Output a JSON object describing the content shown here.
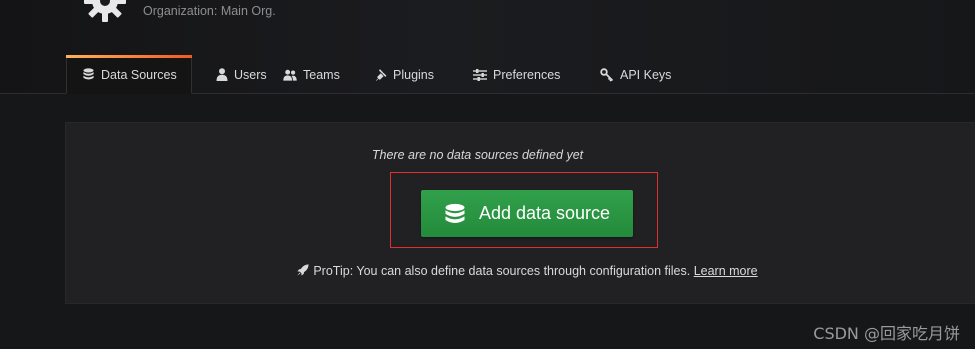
{
  "header": {
    "subtitle": "Organization: Main Org."
  },
  "tabs": [
    {
      "label": "Data Sources",
      "icon": "database-icon",
      "active": true
    },
    {
      "label": "Users",
      "icon": "user-icon",
      "active": false
    },
    {
      "label": "Teams",
      "icon": "users-icon",
      "active": false
    },
    {
      "label": "Plugins",
      "icon": "plug-icon",
      "active": false
    },
    {
      "label": "Preferences",
      "icon": "sliders-icon",
      "active": false
    },
    {
      "label": "API Keys",
      "icon": "key-icon",
      "active": false
    }
  ],
  "empty_state": {
    "message": "There are no data sources defined yet",
    "button_label": "Add data source",
    "protip_text": "ProTip: You can also define data sources through configuration files.",
    "learn_more": "Learn more"
  },
  "colors": {
    "accent_gradient_start": "#ffb357",
    "accent_gradient_end": "#f15a24",
    "button_green": "#2c9a45",
    "highlight_red": "#e02f2f"
  },
  "watermark": "CSDN @回家吃月饼"
}
